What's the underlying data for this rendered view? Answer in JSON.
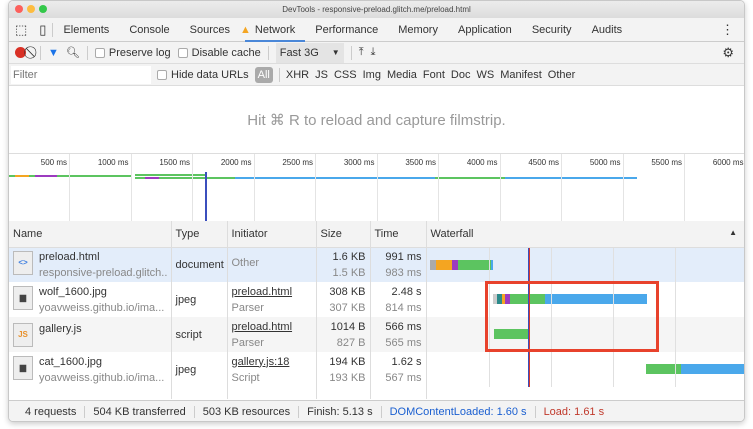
{
  "window": {
    "title": "DevTools - responsive-preload.glitch.me/preload.html"
  },
  "tabs": [
    "Elements",
    "Console",
    "Sources",
    "Network",
    "Performance",
    "Memory",
    "Application",
    "Security",
    "Audits"
  ],
  "toolbar": {
    "preserve_log": "Preserve log",
    "disable_cache": "Disable cache",
    "throttle": "Fast 3G"
  },
  "filter": {
    "placeholder": "Filter",
    "hide_data_urls": "Hide data URLs",
    "types": [
      "All",
      "XHR",
      "JS",
      "CSS",
      "Img",
      "Media",
      "Font",
      "Doc",
      "WS",
      "Manifest",
      "Other"
    ]
  },
  "filmstrip_hint": "Hit ⌘ R to reload and capture filmstrip.",
  "overview_ticks": [
    "500 ms",
    "1000 ms",
    "1500 ms",
    "2000 ms",
    "2500 ms",
    "3000 ms",
    "3500 ms",
    "4000 ms",
    "4500 ms",
    "5000 ms",
    "5500 ms",
    "6000 ms"
  ],
  "columns": [
    "Name",
    "Type",
    "Initiator",
    "Size",
    "Time",
    "Waterfall"
  ],
  "rows": [
    {
      "name": "preload.html",
      "domain": "responsive-preload.glitch...",
      "type": "document",
      "initiator": "Other",
      "initiator_sub": "",
      "size": "1.6 KB",
      "size_sub": "1.5 KB",
      "time": "991 ms",
      "time_sub": "983 ms",
      "icon": "html-file-icon"
    },
    {
      "name": "wolf_1600.jpg",
      "domain": "yoavweiss.github.io/ima...",
      "type": "jpeg",
      "initiator": "preload.html",
      "initiator_sub": "Parser",
      "size": "308 KB",
      "size_sub": "307 KB",
      "time": "2.48 s",
      "time_sub": "814 ms",
      "icon": "image-file-icon"
    },
    {
      "name": "gallery.js",
      "domain": "",
      "type": "script",
      "initiator": "preload.html",
      "initiator_sub": "Parser",
      "size": "1014 B",
      "size_sub": "827 B",
      "time": "566 ms",
      "time_sub": "565 ms",
      "icon": "js-file-icon"
    },
    {
      "name": "cat_1600.jpg",
      "domain": "yoavweiss.github.io/ima...",
      "type": "jpeg",
      "initiator": "gallery.js:18",
      "initiator_sub": "Script",
      "size": "194 KB",
      "size_sub": "193 KB",
      "time": "1.62 s",
      "time_sub": "567 ms",
      "icon": "image-file-icon"
    }
  ],
  "status": {
    "requests": "4 requests",
    "transferred": "504 KB transferred",
    "resources": "503 KB resources",
    "finish": "Finish: 5.13 s",
    "dcl": "DOMContentLoaded: 1.60 s",
    "load": "Load: 1.61 s"
  },
  "colors": {
    "waiting": "#5cc460",
    "receiving": "#4aa8eb",
    "dcl": "#3b4fbd",
    "load": "#d93a2c",
    "highlight": "#e8422c"
  }
}
